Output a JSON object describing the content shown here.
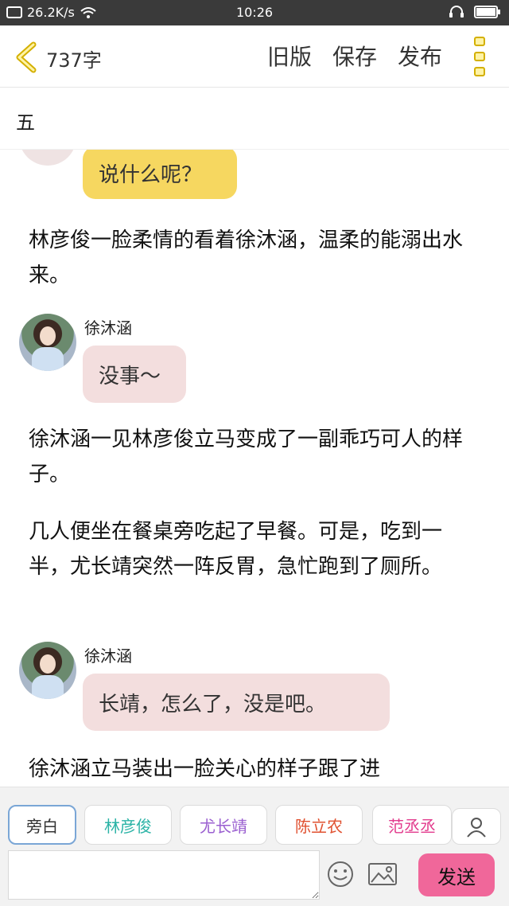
{
  "status_bar": {
    "network_speed": "26.2K/s",
    "time": "10:26"
  },
  "header": {
    "word_count": "737字",
    "actions": [
      "旧版",
      "保存",
      "发布"
    ]
  },
  "chapter": {
    "title": "五"
  },
  "content": {
    "messages": [
      {
        "type": "bubble",
        "speaker": "",
        "text": "说什么呢？"
      },
      {
        "type": "narration",
        "text": "林彦俊一脸柔情的看着徐沐涵，温柔的能溺出水来。"
      },
      {
        "type": "bubble",
        "speaker": "徐沐涵",
        "text": "没事～"
      },
      {
        "type": "narration",
        "text": "徐沐涵一见林彦俊立马变成了一副乖巧可人的样子。"
      },
      {
        "type": "narration",
        "text": "几人便坐在餐桌旁吃起了早餐。可是，吃到一半，尤长靖突然一阵反胃，急忙跑到了厕所。"
      },
      {
        "type": "bubble",
        "speaker": "徐沐涵",
        "text": "长靖，怎么了，没是吧。"
      },
      {
        "type": "narration",
        "text": "徐沐涵立马装出一脸关心的样子跟了进"
      }
    ]
  },
  "characters": [
    {
      "label": "旁白",
      "color": "#333333"
    },
    {
      "label": "林彦俊",
      "color": "#2bb3a6"
    },
    {
      "label": "尤长靖",
      "color": "#9a5fd0"
    },
    {
      "label": "陈立农",
      "color": "#e0502f"
    },
    {
      "label": "范丞丞",
      "color": "#e23b8d"
    }
  ],
  "composer": {
    "input_value": "",
    "send_label": "发送"
  },
  "colors": {
    "accent_send": "#f0679a",
    "bubble_yellow": "#f6d760",
    "bubble_pink": "#f3dede",
    "menu_icon": "#d4b000"
  }
}
